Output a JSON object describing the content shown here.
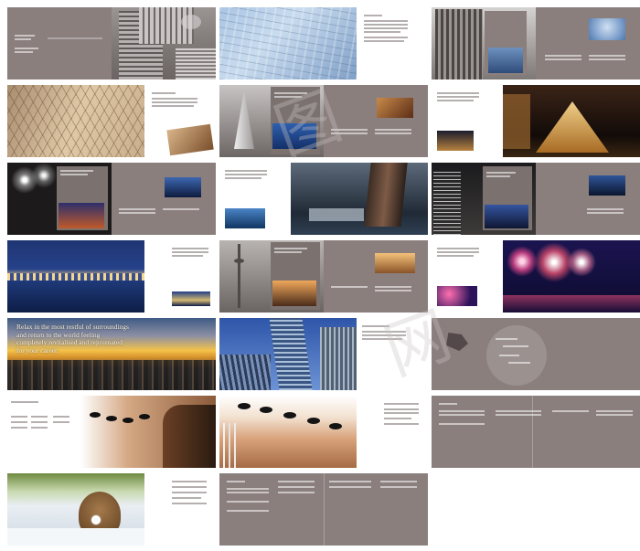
{
  "headline": "Relax in the most restful of surroundings and return to the world feeling completely revitalised and rejuvenated for your career.",
  "colors": {
    "taupe": "#8a7f7d",
    "cream": "#f6efe2"
  },
  "watermark_glyphs": [
    "图",
    "网"
  ],
  "spreads": [
    {
      "name": "spread-cover"
    },
    {
      "name": "spread-glass-tower"
    },
    {
      "name": "spread-skyscraper"
    },
    {
      "name": "spread-facade"
    },
    {
      "name": "spread-burj"
    },
    {
      "name": "spread-louvre"
    },
    {
      "name": "spread-fireworks"
    },
    {
      "name": "spread-landmark-tower"
    },
    {
      "name": "spread-night-city"
    },
    {
      "name": "spread-river-night"
    },
    {
      "name": "spread-tv-tower"
    },
    {
      "name": "spread-fireworks-river"
    },
    {
      "name": "spread-sunset-city"
    },
    {
      "name": "spread-glass-up"
    },
    {
      "name": "spread-map"
    },
    {
      "name": "spread-spa-stones"
    },
    {
      "name": "spread-hot-stones"
    },
    {
      "name": "spread-index"
    },
    {
      "name": "spread-woman-pool"
    },
    {
      "name": "spread-contents"
    }
  ]
}
